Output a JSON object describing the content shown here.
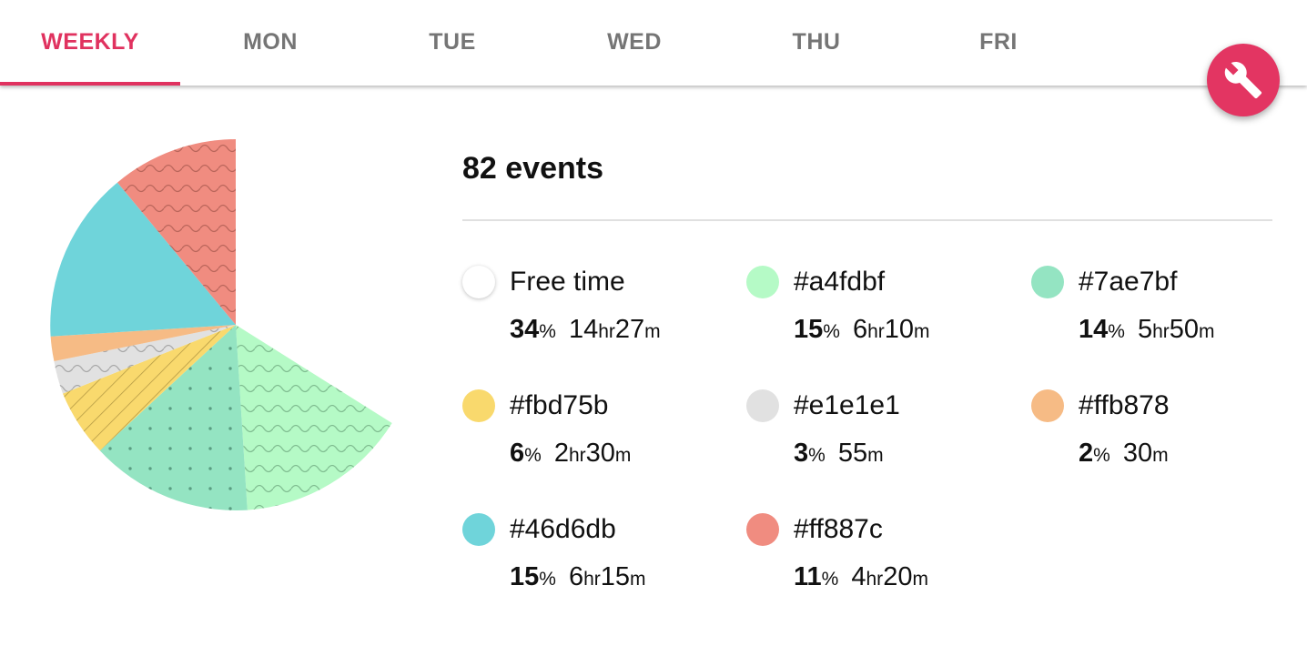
{
  "tabs": [
    {
      "label": "WEEKLY",
      "active": true
    },
    {
      "label": "MON",
      "active": false
    },
    {
      "label": "TUE",
      "active": false
    },
    {
      "label": "WED",
      "active": false
    },
    {
      "label": "THU",
      "active": false
    },
    {
      "label": "FRI",
      "active": false
    }
  ],
  "fab": {
    "icon": "wrench-icon"
  },
  "summary": {
    "count_label": "82 events"
  },
  "legend": [
    {
      "label": "Free time",
      "color": "#ffffff",
      "pct": "34",
      "pct_unit": "%",
      "t1": "14",
      "u1": "hr",
      "t2": "27",
      "u2": "m"
    },
    {
      "label": "#a4fdbf",
      "color": "#b5fac6",
      "pct": "15",
      "pct_unit": "%",
      "t1": "6",
      "u1": "hr",
      "t2": "10",
      "u2": "m"
    },
    {
      "label": "#7ae7bf",
      "color": "#94e4c2",
      "pct": "14",
      "pct_unit": "%",
      "t1": "5",
      "u1": "hr",
      "t2": "50",
      "u2": "m"
    },
    {
      "label": "#fbd75b",
      "color": "#f9d96d",
      "pct": "6",
      "pct_unit": "%",
      "t1": "2",
      "u1": "hr",
      "t2": "30",
      "u2": "m"
    },
    {
      "label": "#e1e1e1",
      "color": "#e1e1e1",
      "pct": "3",
      "pct_unit": "%",
      "t1": "",
      "u1": "",
      "t2": "55",
      "u2": "m"
    },
    {
      "label": "#ffb878",
      "color": "#f6bb85",
      "pct": "2",
      "pct_unit": "%",
      "t1": "",
      "u1": "",
      "t2": "30",
      "u2": "m"
    },
    {
      "label": "#46d6db",
      "color": "#6fd4da",
      "pct": "15",
      "pct_unit": "%",
      "t1": "6",
      "u1": "hr",
      "t2": "15",
      "u2": "m"
    },
    {
      "label": "#ff887c",
      "color": "#f08c80",
      "pct": "11",
      "pct_unit": "%",
      "t1": "4",
      "u1": "hr",
      "t2": "20",
      "u2": "m"
    }
  ],
  "colors": {
    "accent": "#e0325f",
    "fab": "#e33562",
    "tab_inactive": "#757575"
  }
}
